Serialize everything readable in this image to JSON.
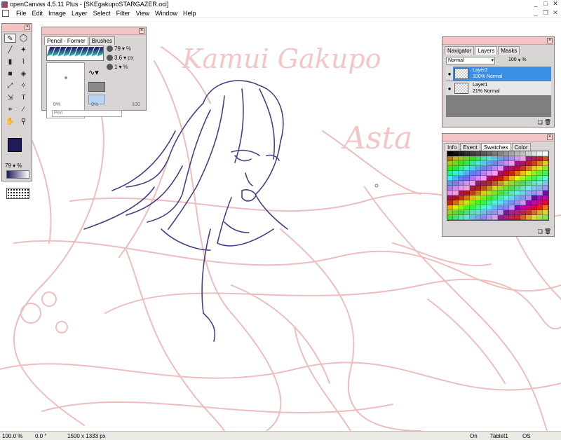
{
  "window": {
    "title": "openCanvas 4.5.11 Plus - [SKEgakupoSTARGAZER.oci]"
  },
  "menu": [
    "File",
    "Edit",
    "Image",
    "Layer",
    "Select",
    "Filter",
    "View",
    "Window",
    "Help"
  ],
  "tools": {
    "items": [
      "pencil-tool",
      "lasso-tool",
      "brush-tool",
      "airbrush-tool",
      "marker-tool",
      "eyedropper-tool",
      "rect-select-tool",
      "fill-tool",
      "move-tool",
      "magic-wand-tool",
      "transform-tool",
      "text-tool",
      "crop-tool",
      "picker-tool",
      "hand-tool",
      "zoom-tool"
    ],
    "opacity_value": "79",
    "opacity_unit": "%",
    "colors": {
      "primary": "#1f1a5c",
      "secondary": "#ffffff"
    }
  },
  "brush_panel": {
    "tabs": [
      "Pencil - Former",
      "Brushes"
    ],
    "active_tab": "Pencil - Former",
    "opacity_value": "79",
    "opacity_unit": "%",
    "size_value": "3.6",
    "size_unit": "px",
    "density_value": "1",
    "density_unit": "%",
    "scale_min": "0%",
    "scale_mid": "0%",
    "scale_max": "100",
    "pen_label": "Pen"
  },
  "layers_panel": {
    "tabs": [
      "Navigator",
      "Layers",
      "Masks"
    ],
    "active_tab": "Layers",
    "blend_mode": "Normal",
    "opacity_value": "100",
    "opacity_unit": "%",
    "layers": [
      {
        "name": "Layer2",
        "info": "100% Normal",
        "selected": true
      },
      {
        "name": "Layer1",
        "info": "21% Normal",
        "selected": false
      }
    ]
  },
  "swatch_panel": {
    "tabs": [
      "Info",
      "Event",
      "Swatches",
      "Color"
    ],
    "active_tab": "Swatches"
  },
  "canvas_text": {
    "line1": "Kamui Gakupo",
    "line2": "Asta"
  },
  "status": {
    "zoom": "100.0 %",
    "angle": "0.0 °",
    "size": "1500 x 1333 px",
    "pen_state": "On",
    "tablet": "Tablet1",
    "coords": "OS Coordinates"
  }
}
